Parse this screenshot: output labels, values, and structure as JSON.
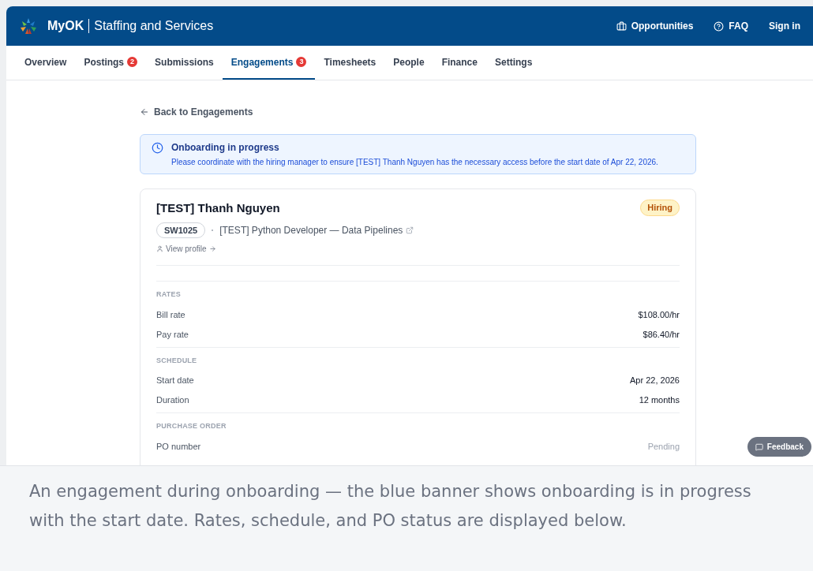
{
  "header": {
    "brand": "MyOK",
    "product": "Staffing and Services",
    "links": [
      {
        "kind": "opportunities",
        "label": "Opportunities"
      },
      {
        "kind": "faq",
        "label": "FAQ"
      },
      {
        "kind": "signin",
        "label": "Sign in"
      }
    ]
  },
  "tabs": [
    {
      "label": "Overview",
      "selected": false
    },
    {
      "label": "Postings",
      "badge": "2",
      "selected": false
    },
    {
      "label": "Submissions",
      "selected": false
    },
    {
      "label": "Engagements",
      "badge": "3",
      "selected": true
    },
    {
      "label": "Timesheets",
      "selected": false
    },
    {
      "label": "People",
      "selected": false
    },
    {
      "label": "Finance",
      "selected": false
    },
    {
      "label": "Settings",
      "selected": false
    }
  ],
  "back_link": "Back to Engagements",
  "banner": {
    "title": "Onboarding in progress",
    "message": "Please coordinate with the hiring manager to ensure [TEST] Thanh Nguyen has the necessary access before the start date of Apr 22, 2026."
  },
  "engagement": {
    "name": "[TEST] Thanh Nguyen",
    "status": "Hiring",
    "code": "SW1025",
    "posting": "[TEST] Python Developer — Data Pipelines",
    "view_profile": "View profile",
    "sections": [
      {
        "heading": "RATES",
        "rows": [
          {
            "label": "Bill rate",
            "value": "$108.00/hr",
            "muted": false
          },
          {
            "label": "Pay rate",
            "value": "$86.40/hr",
            "muted": false
          }
        ]
      },
      {
        "heading": "SCHEDULE",
        "rows": [
          {
            "label": "Start date",
            "value": "Apr 22, 2026",
            "muted": false
          },
          {
            "label": "Duration",
            "value": "12 months",
            "muted": false
          }
        ]
      },
      {
        "heading": "PURCHASE ORDER",
        "rows": [
          {
            "label": "PO number",
            "value": "Pending",
            "muted": true
          }
        ]
      }
    ]
  },
  "feedback_button": "Feedback",
  "caption": "An engagement during onboarding — the blue banner shows onboarding is in progress with the start date. Rates, schedule, and PO status are displayed below."
}
